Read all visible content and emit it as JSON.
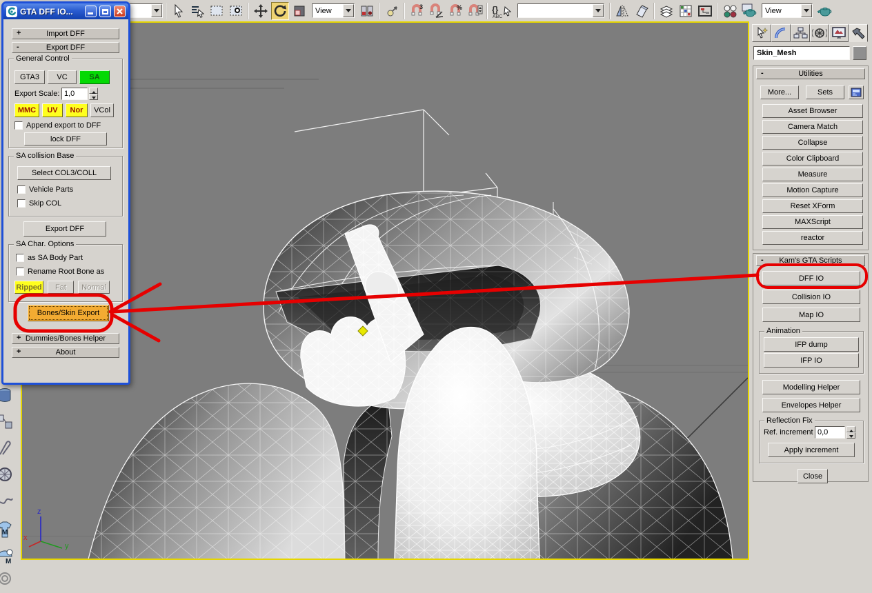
{
  "dialog": {
    "title": "GTA DFF IO...",
    "import_state": "+",
    "import_rollout": "Import DFF",
    "export_state": "-",
    "export_rollout": "Export DFF",
    "general": {
      "label": "General Control",
      "gta3": "GTA3",
      "vc": "VC",
      "sa": "SA",
      "export_scale_label": "Export Scale:",
      "export_scale_value": "1,0",
      "mmc": "MMC",
      "uv": "UV",
      "nor": "Nor",
      "vcol": "VCol",
      "append_label": "Append export to DFF",
      "lock_label": "lock DFF"
    },
    "collision": {
      "label": "SA collision Base",
      "select_label": "Select COL3/COLL",
      "vehicle_label": "Vehicle Parts",
      "skip_label": "Skip COL"
    },
    "export_button": "Export DFF",
    "char_options": {
      "label": "SA Char. Options",
      "body_part_label": "as SA Body Part",
      "rename_label": "Rename Root Bone as",
      "ripped": "Ripped",
      "fat": "Fat",
      "normal": "Normal"
    },
    "bones_skin_label": "Bones/Skin Export",
    "dummies_state": "+",
    "dummies_rollout": "Dummies/Bones Helper",
    "about_state": "+",
    "about_rollout": "About"
  },
  "toolbar": {
    "view_dropdown_1": "View",
    "view_dropdown_2": "View",
    "selection_combo_value": "",
    "named_selection_value": "",
    "snap_3": "3",
    "snap_percent": "%",
    "named_sets_glyph": "{}",
    "named_sets_abc": "ABC"
  },
  "left_toolbar": {
    "m_badge": "M"
  },
  "right_panel": {
    "object_name": "Skin_Mesh",
    "utilities_state": "-",
    "utilities_title": "Utilities",
    "more_label": "More...",
    "sets_label": "Sets",
    "buttons": [
      "Asset Browser",
      "Camera Match",
      "Collapse",
      "Color Clipboard",
      "Measure",
      "Motion Capture",
      "Reset XForm",
      "MAXScript",
      "reactor"
    ],
    "kams_state": "-",
    "kams_title": "Kam's GTA Scripts",
    "dff_io": "DFF IO",
    "collision_io": "Collision IO",
    "map_io": "Map IO",
    "animation_label": "Animation",
    "ifp_dump": "IFP dump",
    "ifp_io": "IFP IO",
    "modelling_helper": "Modelling Helper",
    "envelopes_helper": "Envelopes Helper",
    "reflection_label": "Reflection Fix",
    "ref_increment_label": "Ref. increment",
    "ref_increment_value": "0,0",
    "apply_increment": "Apply increment",
    "close_label": "Close"
  },
  "viewport": {
    "axis_x": "x",
    "axis_y": "y",
    "axis_z": "z"
  },
  "colors": {
    "annotation_red": "#e60000",
    "active_green": "#04d904",
    "flag_yellow": "#ffff1e",
    "bones_orange": "#f3ab32",
    "viewport_gray": "#7d7d7d",
    "active_tool_yellow": "#eed372",
    "viewport_border_yellow": "#e6d600"
  }
}
